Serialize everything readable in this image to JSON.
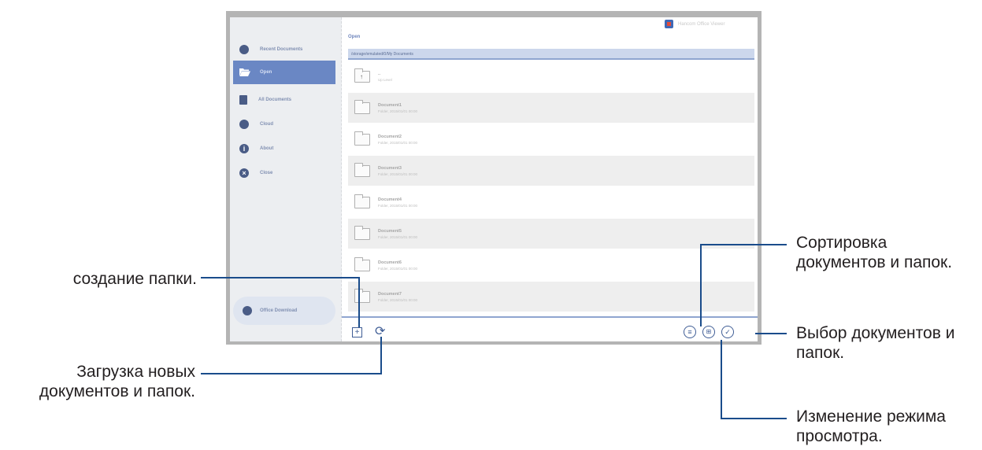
{
  "app": {
    "brand": "Hancom Office Viewer",
    "open_title": "Open",
    "path": "/storage/emulated/0/My Documents"
  },
  "sidebar": {
    "items": [
      {
        "label": "Recent Documents",
        "icon": "clock-icon"
      },
      {
        "label": "Open",
        "icon": "folder-open-icon"
      },
      {
        "label": "All Documents",
        "icon": "document-icon"
      },
      {
        "label": "Cloud",
        "icon": "cloud-icon"
      },
      {
        "label": "About",
        "icon": "info-icon"
      },
      {
        "label": "Close",
        "icon": "close-icon"
      }
    ],
    "download_label": "Office Download"
  },
  "list": {
    "up_row": {
      "name": "..",
      "sub": "Up Level"
    },
    "rows": [
      {
        "name": "Document1",
        "sub": "Folder, 2015/01/01 00:00"
      },
      {
        "name": "Document2",
        "sub": "Folder, 2015/01/01 00:00"
      },
      {
        "name": "Document3",
        "sub": "Folder, 2015/01/01 00:00"
      },
      {
        "name": "Document4",
        "sub": "Folder, 2015/01/01 00:00"
      },
      {
        "name": "Document5",
        "sub": "Folder, 2015/01/01 00:00"
      },
      {
        "name": "Document6",
        "sub": "Folder, 2015/01/01 00:00"
      },
      {
        "name": "Document7",
        "sub": "Folder, 2015/01/01 00:00"
      }
    ]
  },
  "toolbar": {
    "new_folder_icon": "new-folder-icon",
    "refresh_icon": "refresh-icon",
    "sort_icon": "sort-icon",
    "view_mode_icon": "view-mode-icon",
    "select_icon": "select-check-icon"
  },
  "callouts": {
    "new_folder": "создание папки.",
    "refresh_line1": "Загрузка новых",
    "refresh_line2": "документов и папок.",
    "sort_line1": "Сортировка",
    "sort_line2": "документов и папок.",
    "select_line1": "Выбор документов и",
    "select_line2": "папок.",
    "view_line1": "Изменение режима",
    "view_line2": "просмотра."
  },
  "colors": {
    "accent": "#6a87c4",
    "callout_line": "#1a4c8b",
    "icon": "#3f5d95"
  }
}
